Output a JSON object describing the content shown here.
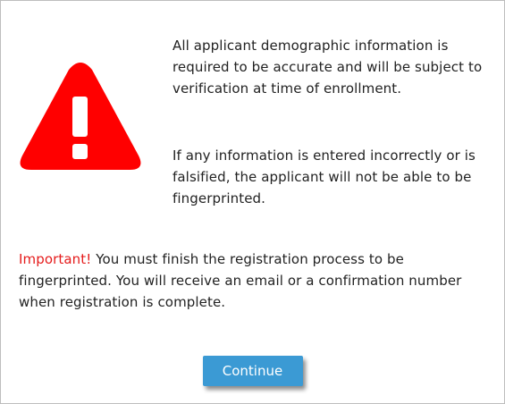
{
  "dialog": {
    "icon": "warning-triangle-icon",
    "icon_color": "#ff0000",
    "paragraph_1": "All applicant demographic information is required to be accurate and will be subject to verification at time of enrollment.",
    "paragraph_2": "If any information is entered incorrectly or is falsified, the applicant will not be able to be fingerprinted.",
    "important_label": "Important!",
    "important_text": " You must finish the registration process to be fingerprinted. You will receive an email or a confirmation number when registration is complete.",
    "continue_label": "Continue",
    "button_color": "#3b9ad4",
    "important_color": "#e51c1c"
  }
}
